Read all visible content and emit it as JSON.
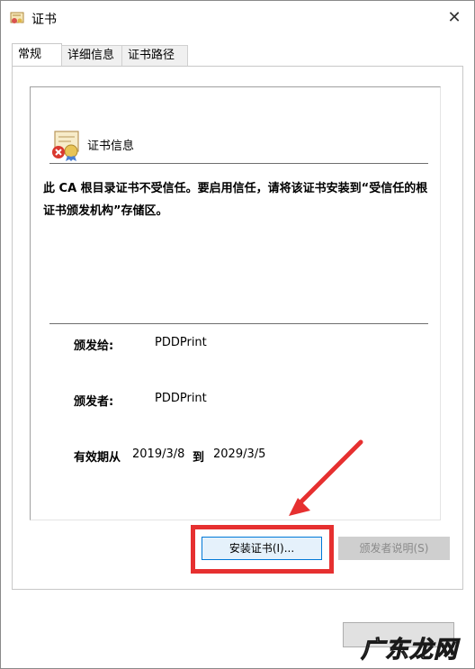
{
  "window": {
    "title": "证书",
    "close_label": "✕"
  },
  "tabs": [
    {
      "label": "常规",
      "active": true
    },
    {
      "label": "详细信息",
      "active": false
    },
    {
      "label": "证书路径",
      "active": false
    }
  ],
  "cert_info": {
    "heading": "证书信息",
    "warning": "此 CA 根目录证书不受信任。要启用信任，请将该证书安装到“受信任的根证书颁发机构”存储区。",
    "issued_to_label": "颁发给:",
    "issued_to_value": "PDDPrint",
    "issued_by_label": "颁发者:",
    "issued_by_value": "PDDPrint",
    "valid_label": "有效期从",
    "valid_from": "2019/3/8",
    "valid_to_label": "到",
    "valid_to": "2029/3/5"
  },
  "buttons": {
    "install": "安装证书(I)...",
    "issuer_statement": "颁发者说明(S)"
  },
  "annotation": {
    "highlight_color": "#e63030"
  },
  "watermark": {
    "text": "广东龙网"
  },
  "icons": {
    "title_icon": "certificate-icon",
    "cert_icon": "certificate-error-icon",
    "close_icon": "close-icon"
  }
}
